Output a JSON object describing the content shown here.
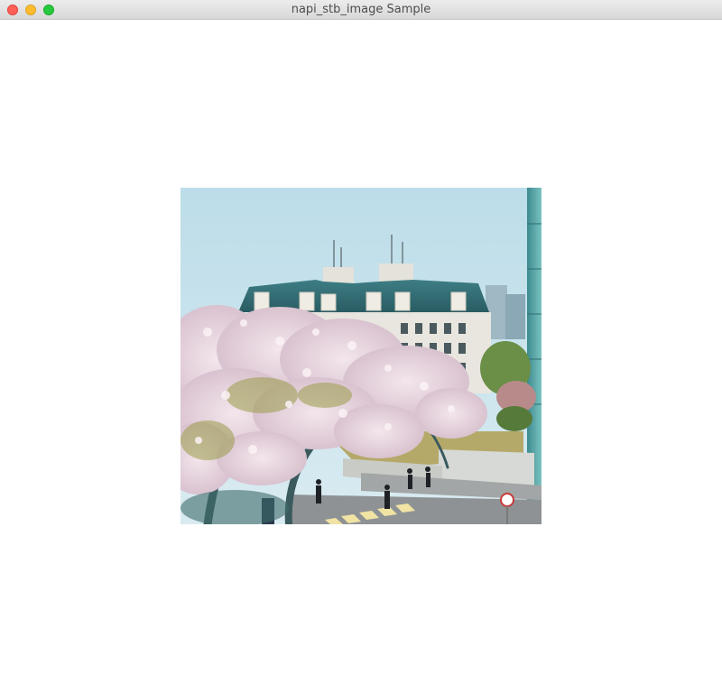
{
  "window": {
    "title": "napi_stb_image Sample",
    "controls": {
      "close": {
        "icon": "close-circle-icon",
        "color": "#fe5f57"
      },
      "minimize": {
        "icon": "minimize-circle-icon",
        "color": "#febb2e"
      },
      "maximize": {
        "icon": "maximize-circle-icon",
        "color": "#28c840"
      }
    }
  },
  "content": {
    "background": "#ffffff",
    "image": {
      "subject": "cherry-blossom-campus-photo"
    }
  }
}
